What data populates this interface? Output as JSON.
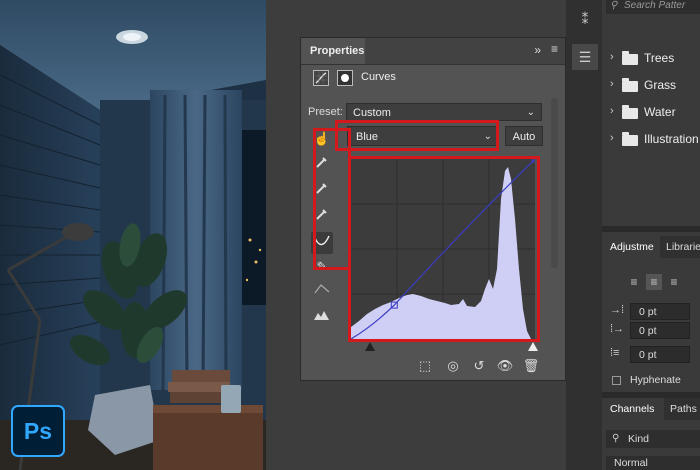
{
  "properties_panel": {
    "tab_label": "Properties",
    "collapse_icon": "double-chevron-right-icon",
    "menu_icon": "hamburger-menu-icon",
    "adjustment_label": "Curves",
    "preset_label": "Preset:",
    "preset_value": "Custom",
    "channel_value": "Blue",
    "auto_label": "Auto",
    "tools": [
      "on-image-adjust-icon",
      "sample-black-eyedropper-icon",
      "sample-gray-eyedropper-icon",
      "sample-white-eyedropper-icon",
      "edit-points-curve-icon",
      "draw-curve-pencil-icon",
      "smooth-curve-icon",
      "clipping-warning-icon"
    ],
    "bottom_tools": [
      "clip-to-layer-icon",
      "view-previous-state-icon",
      "reset-adjustment-icon",
      "toggle-visibility-icon",
      "delete-adjustment-icon"
    ]
  },
  "curve": {
    "channel": "Blue",
    "points": [
      [
        0,
        0
      ],
      [
        60,
        48
      ],
      [
        255,
        255
      ]
    ],
    "line_color": "#3b3bc4"
  },
  "highlight_color": "#d3191c",
  "right_dock": {
    "search_placeholder": "Search Patter",
    "pattern_folders": [
      "Trees",
      "Grass",
      "Water",
      "Illustration"
    ],
    "tabs_top": [
      "Adjustme",
      "Librarie"
    ],
    "spacing_fields": [
      "0 pt",
      "0 pt",
      "0 pt"
    ],
    "hyphenate_label": "Hyphenate",
    "tabs_bottom": [
      "Channels",
      "Paths"
    ],
    "kind_label": "Kind",
    "blend_mode": "Normal"
  },
  "app_logo_text": "Ps"
}
